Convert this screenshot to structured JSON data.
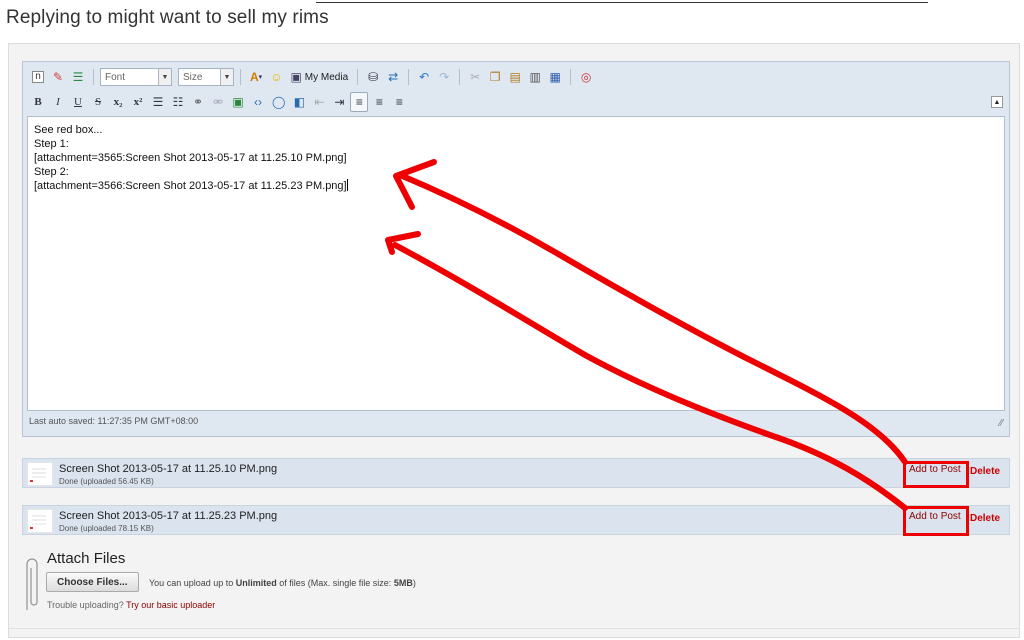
{
  "page": {
    "title": "Replying to might want to sell my rims"
  },
  "toolbar": {
    "font_select": "Font",
    "size_select": "Size",
    "my_media_label": "My Media",
    "bold": "B",
    "italic": "I",
    "underline": "U",
    "strike": "S",
    "subscript": "x₂",
    "superscript": "x²"
  },
  "editor": {
    "lines": [
      "See red box...",
      "",
      "Step 1:",
      "[attachment=3565:Screen Shot 2013-05-17 at 11.25.10 PM.png]",
      "",
      "Step 2:",
      "[attachment=3566:Screen Shot 2013-05-17 at 11.25.23 PM.png]"
    ],
    "autosave": "Last auto saved: 11:27:35 PM GMT+08:00"
  },
  "attachments": [
    {
      "name": "Screen Shot 2013-05-17 at 11.25.10 PM.png",
      "status": "Done (uploaded 56.45 KB)",
      "add_label": "Add to Post",
      "delete_label": "Delete"
    },
    {
      "name": "Screen Shot 2013-05-17 at 11.25.23 PM.png",
      "status": "Done (uploaded 78.15 KB)",
      "add_label": "Add to Post",
      "delete_label": "Delete"
    }
  ],
  "attach": {
    "title": "Attach Files",
    "choose_label": "Choose Files...",
    "info_prefix": "You can upload up to ",
    "info_bold": "Unlimited",
    "info_middle": " of files (Max. single file size: ",
    "info_size": "5MB",
    "info_suffix": ")",
    "trouble_prefix": "Trouble uploading? ",
    "trouble_link": "Try our basic uploader"
  },
  "colors": {
    "annotation_red": "#ee0000",
    "toolbar_bg": "#dfe7f1",
    "link_red": "#8b0000"
  }
}
